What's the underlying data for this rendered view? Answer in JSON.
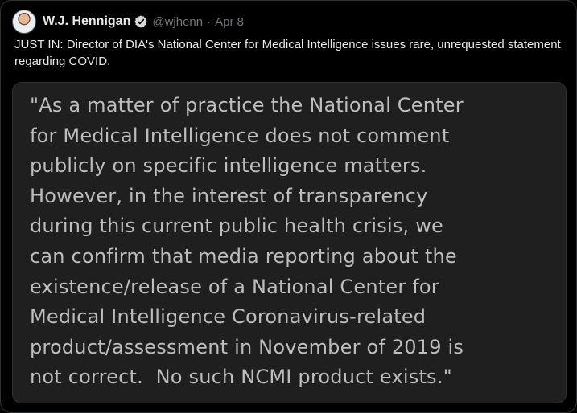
{
  "author": {
    "name": "W.J. Hennigan",
    "handle": "@wjhenn",
    "separator": "·",
    "date": "Apr 8",
    "verified": true
  },
  "tweet": {
    "text": "JUST IN: Director of DIA's National Center for Medical Intelligence issues rare, unrequested statement regarding COVID."
  },
  "media": {
    "lines": [
      "\"As a matter of practice the National Center",
      "for Medical Intelligence does not comment",
      "publicly on specific intelligence matters.",
      "However, in the interest of transparency",
      "during this current public health crisis, we",
      "can confirm that media reporting about the",
      "existence/release of a National Center for",
      "Medical Intelligence Coronavirus-related",
      "product/assessment in November of 2019 is",
      "not correct.  No such NCMI product exists.\""
    ]
  },
  "colors": {
    "background": "#000000",
    "primary_text": "#e7e9ea",
    "secondary_text": "#71767b",
    "verified": "#d9d9d9",
    "image_background": "#1f1f1f",
    "image_text": "#bdbdbd"
  },
  "icons": {
    "verified": "verified-badge-icon",
    "avatar": "profile-avatar"
  }
}
